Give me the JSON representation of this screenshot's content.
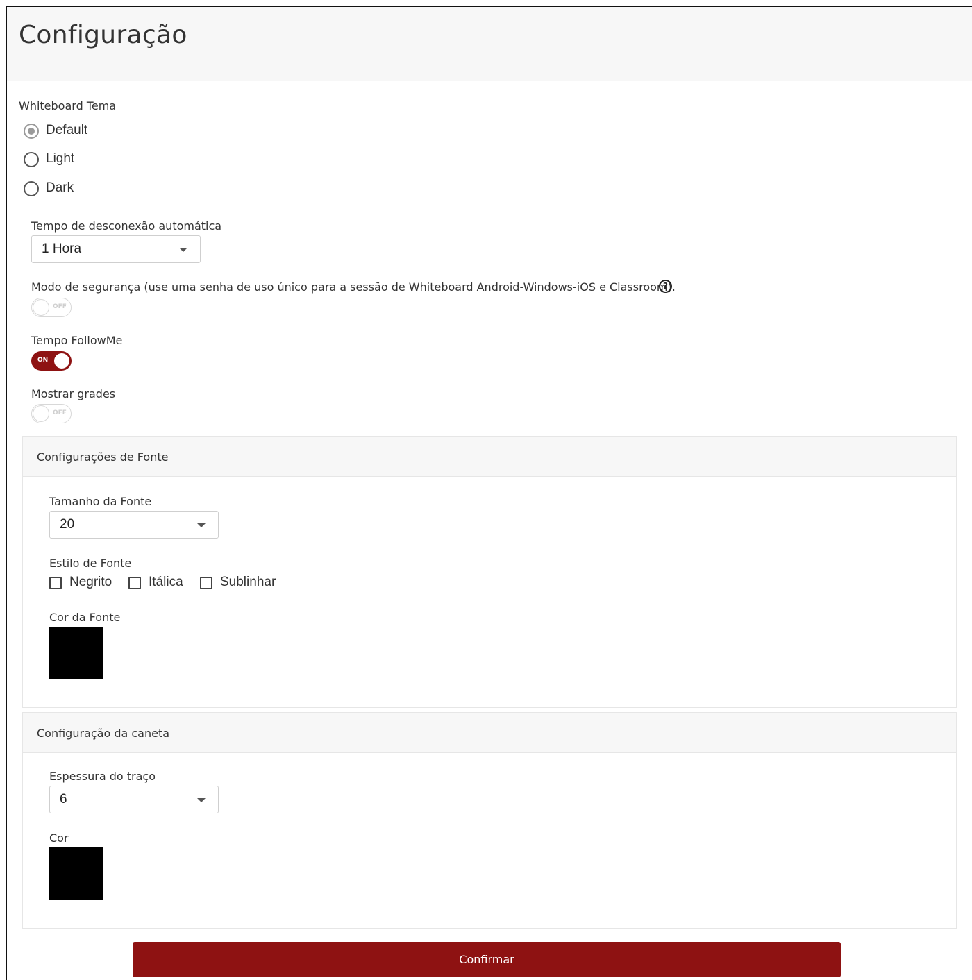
{
  "header": {
    "title": "Configuração"
  },
  "theme": {
    "label": "Whiteboard Tema",
    "options": [
      {
        "label": "Default",
        "selected": true
      },
      {
        "label": "Light",
        "selected": false
      },
      {
        "label": "Dark",
        "selected": false
      }
    ]
  },
  "auto_disconnect": {
    "label": "Tempo de desconexão automática",
    "value": "1 Hora"
  },
  "security_mode": {
    "label": "Modo de segurança (use uma senha de uso único para a sessão de Whiteboard Android-Windows-iOS e Classroom).",
    "help_icon": "?",
    "toggle_state": "OFF"
  },
  "followme": {
    "label": "Tempo FollowMe",
    "toggle_state": "ON"
  },
  "show_grid": {
    "label": "Mostrar grades",
    "toggle_state": "OFF"
  },
  "font_settings": {
    "title": "Configurações de Fonte",
    "size_label": "Tamanho da Fonte",
    "size_value": "20",
    "style_label": "Estilo de Fonte",
    "styles": [
      {
        "label": "Negrito",
        "checked": false
      },
      {
        "label": "Itálica",
        "checked": false
      },
      {
        "label": "Sublinhar",
        "checked": false
      }
    ],
    "color_label": "Cor da Fonte",
    "color": "#000000"
  },
  "pen_settings": {
    "title": "Configuração da caneta",
    "thickness_label": "Espessura do traço",
    "thickness_value": "6",
    "color_label": "Cor",
    "color": "#000000"
  },
  "confirm_label": "Confirmar",
  "accent_color": "#8e1212"
}
